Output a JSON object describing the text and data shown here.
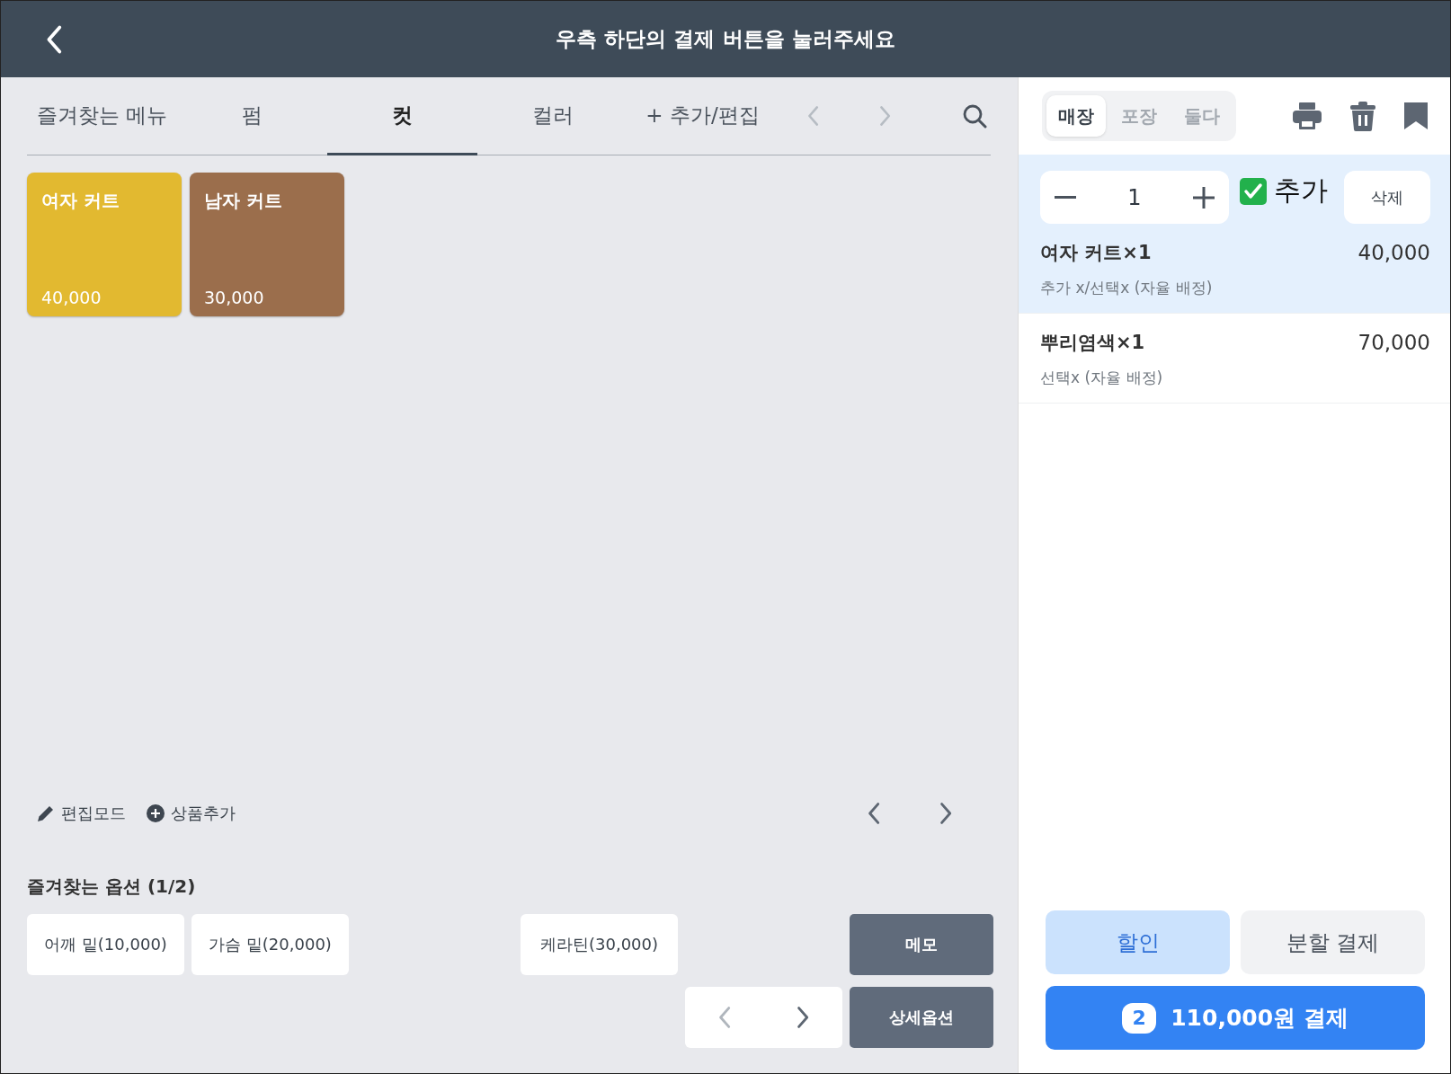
{
  "header": {
    "title": "우측 하단의 결제 버튼을 눌러주세요"
  },
  "category_tabs": [
    {
      "label": "즐겨찾는 메뉴",
      "selected": false
    },
    {
      "label": "펌",
      "selected": false
    },
    {
      "label": "컷",
      "selected": true
    },
    {
      "label": "컬러",
      "selected": false
    }
  ],
  "add_edit_button": "+ 추가/편집",
  "products": [
    {
      "name": "여자 커트",
      "price": "40,000",
      "color": "#e2b930"
    },
    {
      "name": "남자 커트",
      "price": "30,000",
      "color": "#9b6e4c"
    }
  ],
  "tools": [
    {
      "kind": "edit",
      "label": "편집모드"
    },
    {
      "kind": "add",
      "label": "상품추가"
    }
  ],
  "option_section": {
    "title": "즐겨찾는 옵션 (1/2)",
    "options": [
      {
        "label": "어깨 밑(10,000)"
      },
      {
        "label": "가슴 밑(20,000)"
      },
      {
        "label": "케라틴(30,000)"
      }
    ],
    "memo_button": "메모",
    "detail_button": "상세옵션",
    "pager": {
      "prev_disabled": true,
      "next_disabled": false
    }
  },
  "order_type": [
    {
      "label": "매장",
      "selected": true
    },
    {
      "label": "포장",
      "selected": false
    },
    {
      "label": "둘다",
      "selected": false
    }
  ],
  "editor": {
    "quantity": "1",
    "add_label": "추가",
    "add_checked": true,
    "delete_button": "삭제"
  },
  "order_items": [
    {
      "name": "여자 커트×1",
      "price": "40,000",
      "detail": "추가 x/선택x (자율 배정)",
      "selected": true
    },
    {
      "name": "뿌리염색×1",
      "price": "70,000",
      "detail": "선택x (자율 배정)",
      "selected": false
    }
  ],
  "discount_button": "할인",
  "split_button": "분할 결제",
  "pay_button": {
    "count": "2",
    "label": "110,000원 결제"
  }
}
